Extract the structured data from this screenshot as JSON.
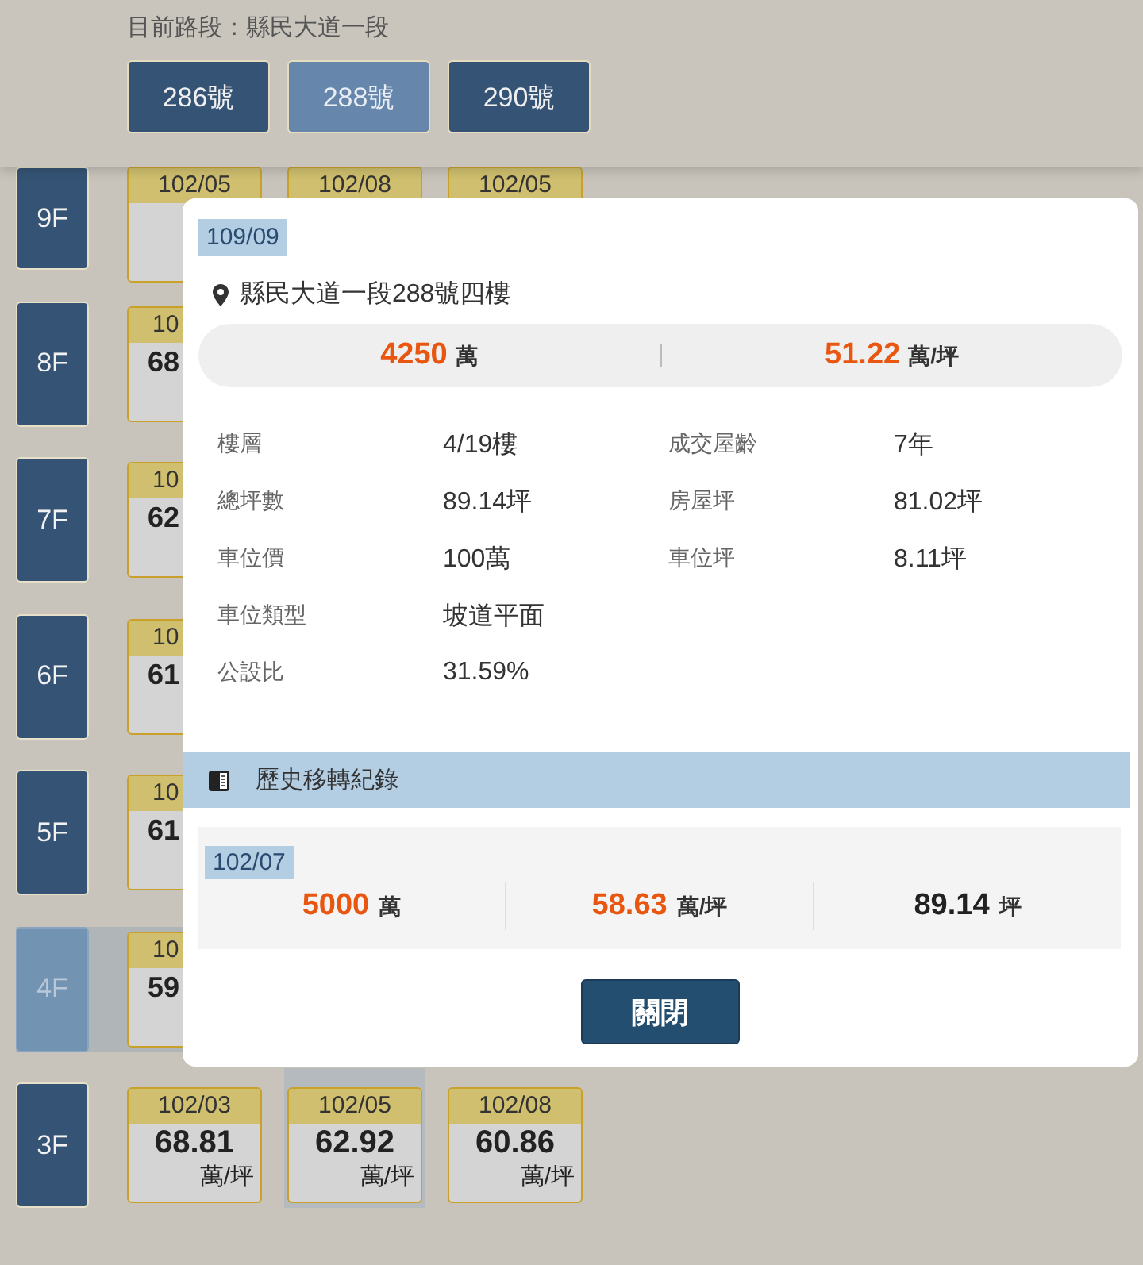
{
  "route": {
    "label": "目前路段：縣民大道一段"
  },
  "address_buttons": [
    {
      "label": "286號",
      "selected": false
    },
    {
      "label": "288號",
      "selected": true
    },
    {
      "label": "290號",
      "selected": false
    }
  ],
  "floors": [
    {
      "label": "9F",
      "selected": false,
      "cards": [
        {
          "kind": "header_only",
          "date": "102/05"
        },
        {
          "kind": "header_only",
          "date": "102/08"
        },
        {
          "kind": "header_only",
          "date": "102/05"
        }
      ]
    },
    {
      "label": "8F",
      "selected": false,
      "cards": [
        {
          "kind": "clipped",
          "date": "10",
          "value": "68"
        }
      ]
    },
    {
      "label": "7F",
      "selected": false,
      "cards": [
        {
          "kind": "clipped",
          "date": "10",
          "value": "62"
        }
      ]
    },
    {
      "label": "6F",
      "selected": false,
      "cards": [
        {
          "kind": "clipped",
          "date": "10",
          "value": "61"
        }
      ]
    },
    {
      "label": "5F",
      "selected": false,
      "cards": [
        {
          "kind": "clipped",
          "date": "10",
          "value": "61"
        }
      ]
    },
    {
      "label": "4F",
      "selected": true,
      "cards": [
        {
          "kind": "clipped",
          "date": "10",
          "value": "59"
        }
      ]
    },
    {
      "label": "3F",
      "selected": false,
      "cards": [
        {
          "kind": "full",
          "date": "102/03",
          "value": "68.81",
          "unit": "萬/坪"
        },
        {
          "kind": "full",
          "date": "102/05",
          "value": "62.92",
          "unit": "萬/坪"
        },
        {
          "kind": "full",
          "date": "102/08",
          "value": "60.86",
          "unit": "萬/坪"
        }
      ]
    }
  ],
  "popup": {
    "date": "109/09",
    "address": "縣民大道一段288號四樓",
    "total": {
      "value": "4250",
      "unit": "萬"
    },
    "unit_price": {
      "value": "51.22",
      "unit": "萬/坪"
    },
    "details_left": [
      {
        "label": "樓層",
        "value": "4/19樓"
      },
      {
        "label": "總坪數",
        "value": "89.14坪"
      },
      {
        "label": "車位價",
        "value": "100萬"
      },
      {
        "label": "車位類型",
        "value": "坡道平面"
      },
      {
        "label": "公設比",
        "value": "31.59%"
      }
    ],
    "details_right": [
      {
        "label": "成交屋齡",
        "value": "7年"
      },
      {
        "label": "房屋坪",
        "value": "81.02坪"
      },
      {
        "label": "車位坪",
        "value": "8.11坪"
      }
    ],
    "history_title": "歷史移轉紀錄",
    "history": [
      {
        "date": "102/07",
        "cells": [
          {
            "kind": "price",
            "value": "5000",
            "unit": "萬"
          },
          {
            "kind": "price",
            "value": "58.63",
            "unit": "萬/坪"
          },
          {
            "kind": "area",
            "value": "89.14",
            "unit": "坪"
          }
        ]
      }
    ],
    "close_button": "關閉"
  }
}
